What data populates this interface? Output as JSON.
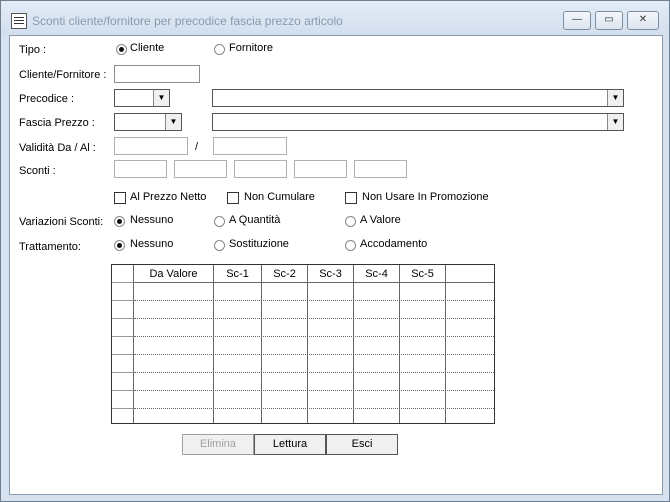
{
  "window": {
    "title": "Sconti cliente/fornitore per precodice fascia prezzo articolo",
    "minimize": "—",
    "maximize": "▭",
    "close": "✕"
  },
  "form": {
    "tipo_label": "Tipo :",
    "tipo_options": [
      "Cliente",
      "Fornitore"
    ],
    "tipo_selected": "Cliente",
    "cliente_fornitore_label": "Cliente/Fornitore :",
    "precodice_label": "Precodice :",
    "fascia_prezzo_label": "Fascia Prezzo :",
    "validita_label": "Validità Da / Al :",
    "validita_sep": "/",
    "sconti_label": "Sconti :",
    "checkbox_prezzo_netto": "Al Prezzo Netto",
    "checkbox_non_cumulare": "Non Cumulare",
    "checkbox_non_usare": "Non Usare In Promozione",
    "variazioni_label": "Variazioni Sconti:",
    "variazioni_options": [
      "Nessuno",
      "A Quantità",
      "A Valore"
    ],
    "variazioni_selected": "Nessuno",
    "trattamento_label": "Trattamento:",
    "trattamento_options": [
      "Nessuno",
      "Sostituzione",
      "Accodamento"
    ],
    "trattamento_selected": "Nessuno"
  },
  "grid": {
    "columns": [
      "Da Valore",
      "Sc-1",
      "Sc-2",
      "Sc-3",
      "Sc-4",
      "Sc-5"
    ],
    "row_count": 7
  },
  "buttons": {
    "elimina": "Elimina",
    "lettura": "Lettura",
    "esci": "Esci"
  }
}
